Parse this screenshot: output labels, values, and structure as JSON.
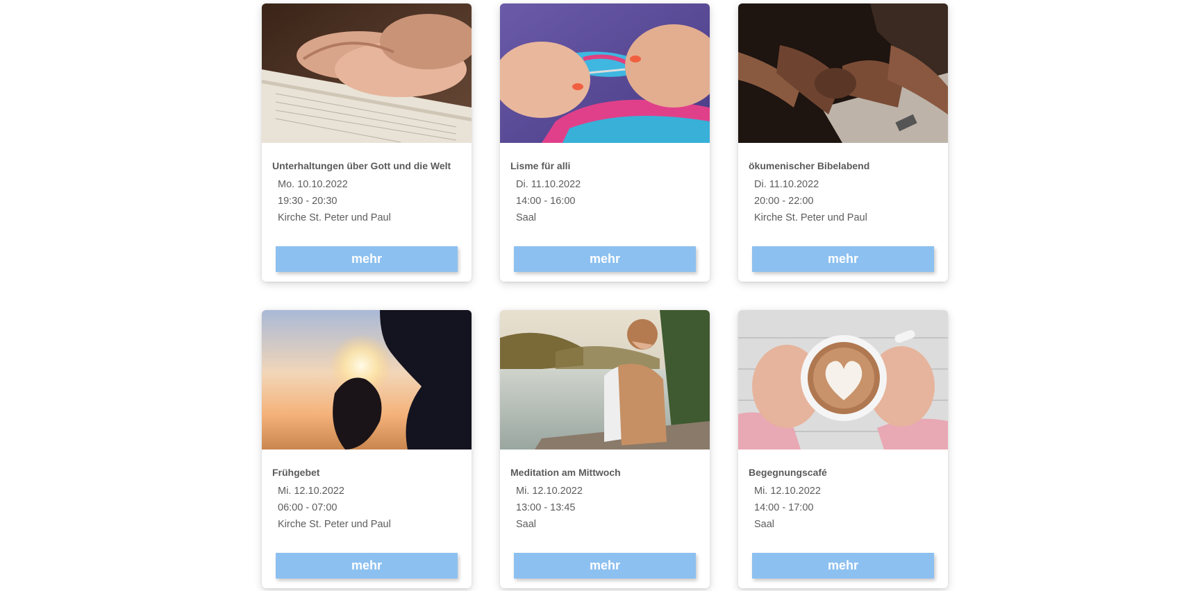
{
  "events": [
    {
      "title": "Unterhaltungen über Gott und die Welt",
      "date": "Mo. 10.10.2022",
      "time": "19:30 - 20:30",
      "location": "Kirche St. Peter und Paul",
      "button": "mehr",
      "image": "hands-on-open-bible"
    },
    {
      "title": "Lisme für alli",
      "date": "Di. 11.10.2022",
      "time": "14:00 - 16:00",
      "location": "Saal",
      "button": "mehr",
      "image": "hands-knitting-colorful-yarn"
    },
    {
      "title": "ökumenischer Bibelabend",
      "date": "Di. 11.10.2022",
      "time": "20:00 - 22:00",
      "location": "Kirche St. Peter und Paul",
      "button": "mehr",
      "image": "people-holding-hands-praying"
    },
    {
      "title": "Frühgebet",
      "date": "Mi. 12.10.2022",
      "time": "06:00 - 07:00",
      "location": "Kirche St. Peter und Paul",
      "button": "mehr",
      "image": "silhouette-praying-at-sunrise"
    },
    {
      "title": "Meditation am Mittwoch",
      "date": "Mi. 12.10.2022",
      "time": "13:00 - 13:45",
      "location": "Saal",
      "button": "mehr",
      "image": "woman-with-backpack-at-lake"
    },
    {
      "title": "Begegnungscafé",
      "date": "Mi. 12.10.2022",
      "time": "14:00 - 17:00",
      "location": "Saal",
      "button": "mehr",
      "image": "hands-holding-latte-heart"
    }
  ],
  "colors": {
    "button": "#8cc0f0",
    "button_text": "#ffffff",
    "text": "#5a5a5a"
  }
}
